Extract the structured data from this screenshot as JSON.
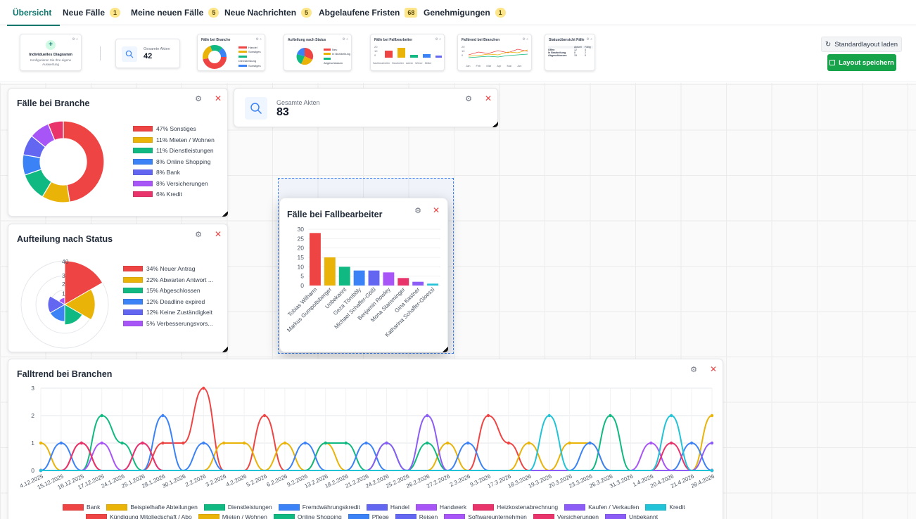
{
  "tabs": [
    {
      "label": "Übersicht",
      "badge": ""
    },
    {
      "label": "Neue Fälle",
      "badge": "1"
    },
    {
      "label": "Meine neuen Fälle",
      "badge": "5"
    },
    {
      "label": "Neue Nachrichten",
      "badge": "5"
    },
    {
      "label": "Abgelaufene Fristen",
      "badge": "68"
    },
    {
      "label": "Genehmigungen",
      "badge": "1"
    }
  ],
  "palette": {
    "custom": {
      "title": "Individuelles Diagramm",
      "subtitle": "Konfigurieren Sie Ihre eigene Auswertung"
    },
    "total": {
      "label": "Gesamte Akten",
      "value": "42"
    },
    "branche": {
      "title": "Fälle bei Branche",
      "legend": [
        "Handel",
        "Sonstiges",
        "Dienstleistung",
        "Sonstiges"
      ]
    },
    "status": {
      "title": "Aufteilung nach Status",
      "legend": [
        "Neu",
        "In Bearbeitung",
        "Abgeschlossen"
      ]
    },
    "bearbeiter": {
      "title": "Fälle bei Fallbearbeiter",
      "ticks": [
        "20",
        "10",
        "0"
      ],
      "labels": [
        "Sachbearbeiter",
        "Bearbeiter",
        "Admin",
        "Weber",
        "Müller"
      ]
    },
    "trend": {
      "title": "Falltrend bei Branchen",
      "ticks": [
        "20",
        "10",
        "0"
      ],
      "labels": [
        "Jan",
        "Feb",
        "Mär",
        "Apr",
        "Mai",
        "Jun"
      ]
    },
    "overview": {
      "title": "Statusübersicht Fälle",
      "headers": [
        "",
        "Aktuell",
        "Fällig"
      ],
      "rows": [
        [
          "Offen",
          "12",
          "4"
        ],
        [
          "In Bearbeitung",
          "8",
          "2"
        ],
        [
          "Abgeschlossen",
          "15",
          "0"
        ]
      ]
    },
    "btn_default": "Standardlayout laden",
    "btn_save": "Layout speichern"
  },
  "widgets": {
    "branche": {
      "title": "Fälle bei Branche",
      "legend": [
        "47% Sonstiges",
        "11% Mieten / Wohnen",
        "11% Dienstleistungen",
        "8% Online Shopping",
        "8% Bank",
        "8% Versicherungen",
        "6% Kredit"
      ]
    },
    "status": {
      "title": "Aufteilung nach Status",
      "legend": [
        "34% Neuer Antrag",
        "22% Abwarten Antwort ...",
        "15% Abgeschlossen",
        "12% Deadline expired",
        "12% Keine Zuständigkeit",
        "5% Verbesserungsvors..."
      ]
    },
    "total": {
      "label": "Gesamte Akten",
      "value": "83"
    },
    "bearbeiter": {
      "title": "Fälle bei Fallbearbeiter"
    },
    "trend": {
      "title": "Falltrend bei Branchen"
    }
  },
  "colors": {
    "red": "#ef4444",
    "yellow": "#eab308",
    "green": "#10b981",
    "blue": "#3b82f6",
    "indigo": "#6366f1",
    "purple": "#a855f7",
    "pink": "#e8336b",
    "violet": "#8b5cf6",
    "cyan": "#22c3d6",
    "accent": "#0f766e",
    "save": "#16a34a"
  },
  "chart_data": [
    {
      "type": "pie",
      "title": "Fälle bei Branche",
      "categories": [
        "Sonstiges",
        "Mieten / Wohnen",
        "Dienstleistungen",
        "Online Shopping",
        "Bank",
        "Versicherungen",
        "Kredit"
      ],
      "values": [
        47,
        11,
        11,
        8,
        8,
        8,
        6
      ],
      "donut": true,
      "legend": "right"
    },
    {
      "type": "polar-area",
      "title": "Aufteilung nach Status",
      "categories": [
        "Neuer Antrag",
        "Abwarten Antwort ...",
        "Abgeschlossen",
        "Deadline expired",
        "Keine Zuständigkeit",
        "Verbesserungsvors..."
      ],
      "percent": [
        34,
        22,
        15,
        12,
        12,
        5
      ],
      "values": [
        28,
        18,
        12,
        10,
        10,
        4
      ],
      "r_ticks": [
        "40",
        "3",
        "2",
        "1"
      ],
      "legend": "right"
    },
    {
      "type": "bar",
      "title": "Fälle bei Fallbearbeiter",
      "categories": [
        "Tobias Wilharm",
        "Markus Gumpoltsberger",
        "Unbekannt",
        "Geza Tömböly",
        "Michael Schaffer-Gößl",
        "Benjamin Rowley",
        "Mona Stamminger",
        "Gina Kastner",
        "Katharina Schaffer-Gloessl"
      ],
      "values": [
        28,
        15,
        10,
        8,
        8,
        7,
        4,
        2,
        1
      ],
      "ylim": [
        0,
        30
      ],
      "yticks": [
        0,
        5,
        10,
        15,
        20,
        25,
        30
      ]
    },
    {
      "type": "line",
      "title": "Falltrend bei Branchen",
      "x": [
        "4.12.2025",
        "15.12.2025",
        "16.12.2025",
        "17.12.2025",
        "24.1.2026",
        "25.1.2026",
        "28.1.2026",
        "30.1.2026",
        "2.2.2026",
        "3.2.2026",
        "4.2.2026",
        "5.2.2026",
        "6.2.2026",
        "9.2.2026",
        "13.2.2026",
        "18.2.2026",
        "21.2.2026",
        "24.2.2026",
        "25.2.2026",
        "26.2.2026",
        "27.2.2026",
        "2.3.2026",
        "9.3.2026",
        "17.3.2026",
        "18.3.2026",
        "19.3.2026",
        "20.3.2026",
        "23.3.2026",
        "26.3.2026",
        "31.3.2026",
        "1.4.2026",
        "20.4.2026",
        "21.4.2026",
        "28.4.2026"
      ],
      "ylim": [
        0,
        3
      ],
      "yticks": [
        0,
        1,
        2,
        3
      ],
      "series": [
        {
          "name": "Bank",
          "color": "#ef4444",
          "values": [
            0,
            0,
            1,
            0,
            0,
            0,
            1,
            1,
            3,
            0,
            0,
            2,
            0,
            0,
            0,
            0,
            0,
            0,
            0,
            0,
            0,
            0,
            2,
            1,
            0,
            0,
            0,
            0,
            0,
            0,
            0,
            0,
            0,
            0
          ]
        },
        {
          "name": "Beispielhafte Abteilungen",
          "color": "#eab308",
          "values": [
            1,
            0,
            0,
            0,
            0,
            0,
            0,
            0,
            0,
            1,
            1,
            0,
            1,
            0,
            1,
            0,
            0,
            0,
            0,
            0,
            1,
            0,
            0,
            0,
            1,
            0,
            1,
            1,
            0,
            0,
            0,
            0,
            0,
            2
          ]
        },
        {
          "name": "Dienstleistungen",
          "color": "#10b981",
          "values": [
            0,
            0,
            0,
            2,
            1,
            0,
            0,
            0,
            0,
            0,
            0,
            0,
            0,
            0,
            1,
            1,
            0,
            1,
            0,
            1,
            0,
            0,
            0,
            0,
            0,
            0,
            0,
            0,
            2,
            0,
            0,
            0,
            0,
            0
          ]
        },
        {
          "name": "Fremdwährungskredit",
          "color": "#3b82f6",
          "values": [
            0,
            1,
            0,
            0,
            0,
            0,
            2,
            0,
            1,
            0,
            0,
            0,
            0,
            1,
            0,
            0,
            1,
            0,
            0,
            0,
            0,
            1,
            0,
            0,
            0,
            0,
            0,
            1,
            0,
            0,
            0,
            0,
            1,
            0
          ]
        },
        {
          "name": "Handel",
          "color": "#6366f1",
          "values": [
            0,
            0,
            0,
            0,
            0,
            0,
            0,
            0,
            0,
            0,
            0,
            0,
            0,
            0,
            0,
            0,
            0,
            0,
            0,
            0,
            0,
            0,
            0,
            0,
            0,
            0,
            0,
            0,
            0,
            0,
            0,
            0,
            0,
            0
          ]
        },
        {
          "name": "Handwerk",
          "color": "#a855f7",
          "values": [
            0,
            0,
            0,
            1,
            0,
            1,
            0,
            0,
            0,
            0,
            0,
            0,
            0,
            0,
            0,
            0,
            0,
            0,
            0,
            0,
            0,
            0,
            0,
            0,
            0,
            0,
            0,
            0,
            0,
            0,
            1,
            0,
            0,
            0
          ]
        },
        {
          "name": "Heizkostenabrechnung",
          "color": "#e8336b",
          "values": [
            0,
            0,
            1,
            0,
            0,
            1,
            0,
            0,
            0,
            0,
            0,
            0,
            0,
            0,
            0,
            0,
            0,
            0,
            0,
            0,
            0,
            0,
            0,
            0,
            0,
            0,
            0,
            0,
            0,
            0,
            0,
            1,
            0,
            0
          ]
        },
        {
          "name": "Kaufen / Verkaufen",
          "color": "#8b5cf6",
          "values": [
            0,
            0,
            0,
            0,
            0,
            0,
            0,
            0,
            0,
            0,
            0,
            0,
            0,
            0,
            0,
            0,
            0,
            1,
            0,
            2,
            0,
            0,
            0,
            0,
            0,
            0,
            0,
            0,
            0,
            0,
            0,
            0,
            0,
            1
          ]
        },
        {
          "name": "Kredit",
          "color": "#22c3d6",
          "values": [
            0,
            0,
            0,
            0,
            0,
            0,
            0,
            0,
            0,
            0,
            0,
            0,
            0,
            0,
            0,
            0,
            0,
            0,
            0,
            0,
            0,
            0,
            0,
            0,
            0,
            2,
            0,
            0,
            0,
            0,
            0,
            2,
            0,
            0
          ]
        },
        {
          "name": "Kündigung Mitgliedschaft / Abo",
          "color": "#ef4444",
          "values": []
        },
        {
          "name": "Mieten / Wohnen",
          "color": "#eab308",
          "values": []
        },
        {
          "name": "Online Shopping",
          "color": "#10b981",
          "values": []
        },
        {
          "name": "Pflege",
          "color": "#3b82f6",
          "values": []
        },
        {
          "name": "Reisen",
          "color": "#6366f1",
          "values": []
        },
        {
          "name": "Softwareunternehmen",
          "color": "#a855f7",
          "values": []
        },
        {
          "name": "Versicherungen",
          "color": "#e8336b",
          "values": []
        },
        {
          "name": "Unbekannt",
          "color": "#8b5cf6",
          "values": []
        }
      ]
    }
  ]
}
